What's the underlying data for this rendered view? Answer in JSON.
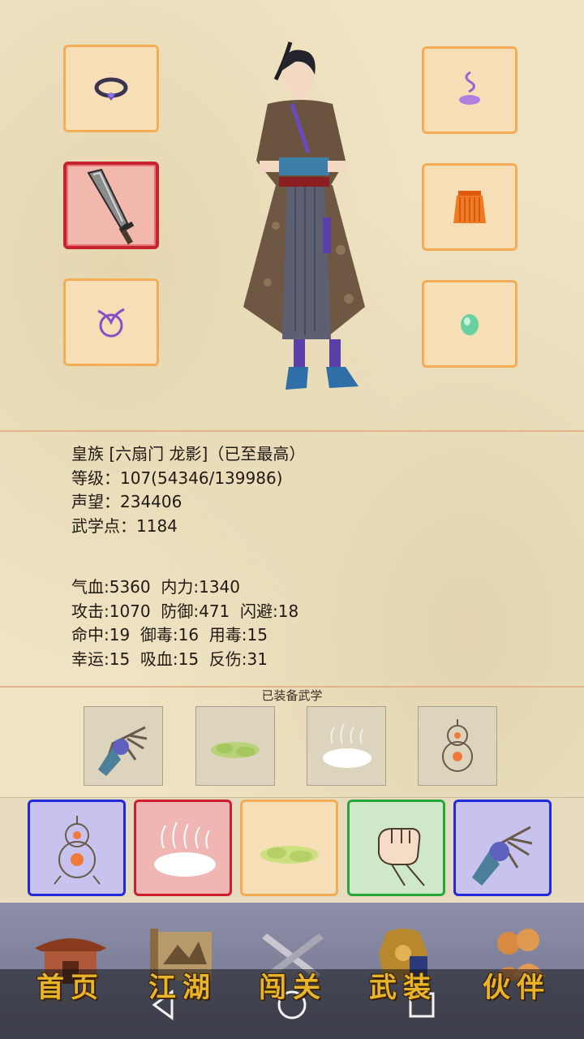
{
  "equipment": {
    "left": [
      {
        "name": "ring",
        "icon": "ring-icon"
      },
      {
        "name": "weapon",
        "icon": "saber-icon"
      },
      {
        "name": "cord",
        "icon": "cord-icon"
      }
    ],
    "right": [
      {
        "name": "hairpin",
        "icon": "hairpin-icon"
      },
      {
        "name": "skirt",
        "icon": "skirt-icon"
      },
      {
        "name": "jade",
        "icon": "jade-icon"
      }
    ]
  },
  "character": {
    "identity": "皇族 [六扇门 龙影]（已至最高）",
    "level": "等级：107(54346/139986)",
    "reputation": "声望：234406",
    "martial_points": "武学点：1184"
  },
  "stats": {
    "line1": "气血:5360  内力:1340",
    "line2": "攻击:1070  防御:471  闪避:18",
    "line3": "命中:19  御毒:16  用毒:15",
    "line4": "幸运:15  吸血:15  反伤:31"
  },
  "equipped_martial_title": "已装备武学",
  "equipped_skills": [
    "palm-skill-icon",
    "poison-mist-skill-icon",
    "qi-cloud-skill-icon",
    "gourd-skill-icon"
  ],
  "skill_bar": [
    {
      "icon": "gourd-skill-icon",
      "frame": "blue"
    },
    {
      "icon": "qi-cloud-skill-icon",
      "frame": "red"
    },
    {
      "icon": "poison-mist-skill-icon",
      "frame": "orange"
    },
    {
      "icon": "fist-skill-icon",
      "frame": "green"
    },
    {
      "icon": "palm-skill-icon",
      "frame": "blue"
    }
  ],
  "nav": {
    "home": "首页",
    "jianghu": "江湖",
    "stage": "闯关",
    "gear": "武装",
    "partner": "伙伴"
  },
  "colors": {
    "slot_border": "#f3ad55",
    "selected_border": "#c6242c",
    "nav_label": "#e8b42a"
  }
}
